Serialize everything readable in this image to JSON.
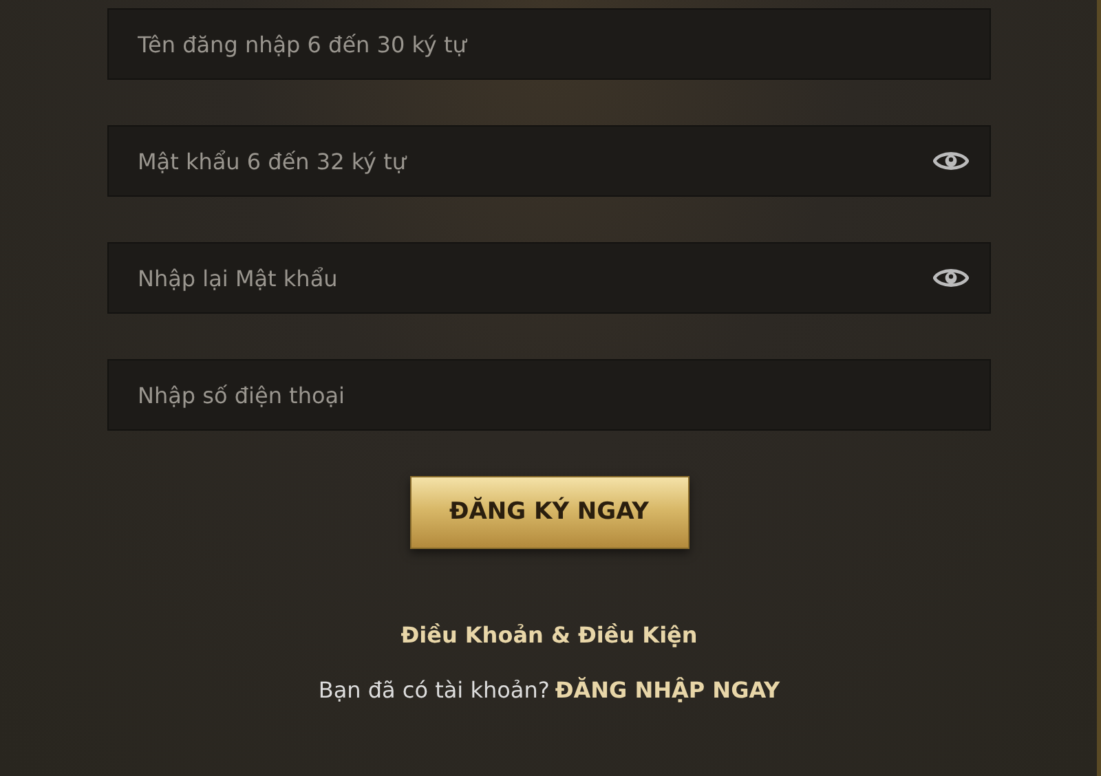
{
  "fields": [
    {
      "placeholder": "Tên đăng nhập 6 đến 30 ký tự",
      "kind": "text"
    },
    {
      "placeholder": "Mật khẩu 6 đến 32 ký tự",
      "kind": "password"
    },
    {
      "placeholder": "Nhập lại Mật khẩu",
      "kind": "password"
    },
    {
      "placeholder": "Nhập số điện thoại",
      "kind": "text"
    }
  ],
  "submit_button": "ĐĂNG KÝ NGAY",
  "terms_link": "Điều Khoản & Điều Kiện",
  "login_prompt": {
    "text": "Bạn đã có tài khoản?",
    "link": "ĐĂNG NHẬP NGAY"
  }
}
